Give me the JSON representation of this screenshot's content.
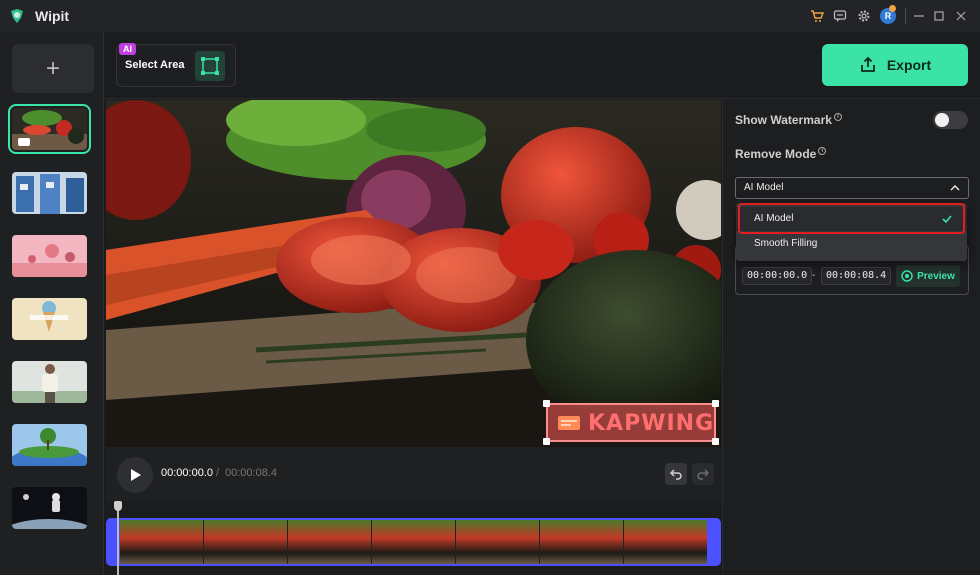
{
  "app": {
    "name": "Wipit"
  },
  "titlebar": {
    "avatar_initial": "R"
  },
  "toolbar": {
    "ai_badge": "AI",
    "select_area_label": "Select Area",
    "export_label": "Export"
  },
  "sidebar": {
    "add_label": "+",
    "thumbnails": [
      {
        "name": "tomatoes-clip",
        "active": true
      },
      {
        "name": "blue-buildings-clip",
        "active": false
      },
      {
        "name": "hot-air-balloons-clip",
        "active": false
      },
      {
        "name": "ice-cream-clip",
        "active": false
      },
      {
        "name": "person-clip",
        "active": false
      },
      {
        "name": "tree-clip",
        "active": false
      },
      {
        "name": "astronaut-clip",
        "active": false
      }
    ]
  },
  "video": {
    "watermark_text": "KAPWING"
  },
  "player": {
    "current_time": "00:00:00.0",
    "separator": "/",
    "total_time": "00:00:08.4"
  },
  "panel": {
    "show_watermark_label": "Show Watermark",
    "remove_mode_label": "Remove Mode",
    "remove_mode_value": "AI Model",
    "start_time": "00:00:00.0",
    "dash": "-",
    "end_time": "00:00:08.4",
    "preview_label": "Preview",
    "toggle_on": false
  },
  "dropdown": {
    "options": [
      "AI Model",
      "Smooth Filling"
    ],
    "selected": "AI Model"
  },
  "colors": {
    "accent": "#3ce3a6",
    "timeline_border": "#4b51ff",
    "highlight_red": "#e21f1f",
    "ai_badge": "#c13ee0"
  }
}
